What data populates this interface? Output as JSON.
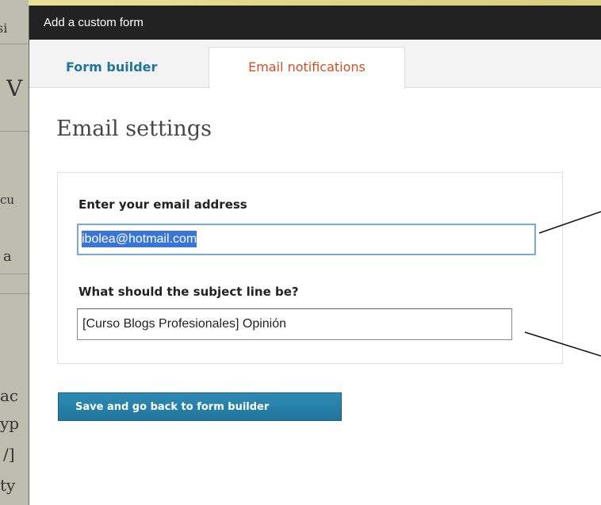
{
  "background_page": {
    "fragments": [
      "si",
      "V",
      "cu",
      "a",
      "ac",
      "yp",
      "/]",
      "ty"
    ]
  },
  "modal": {
    "title": "Add a custom form",
    "tabs": [
      {
        "label": "Form builder",
        "active": false
      },
      {
        "label": "Email notifications",
        "active": true
      }
    ],
    "heading": "Email settings",
    "email": {
      "label": "Enter your email address",
      "value": "ibolea@hotmail.com",
      "selected": true
    },
    "subject": {
      "label": "What should the subject line be?",
      "value": "[Curso Blogs Profesionales] Opinión"
    },
    "save_button": "Save and go back to form builder"
  },
  "colors": {
    "tab_active": "#d54e21",
    "tab_link": "#21759b",
    "button": "#21759b",
    "titlebar": "#222222",
    "backdrop": "#e3d98a"
  }
}
